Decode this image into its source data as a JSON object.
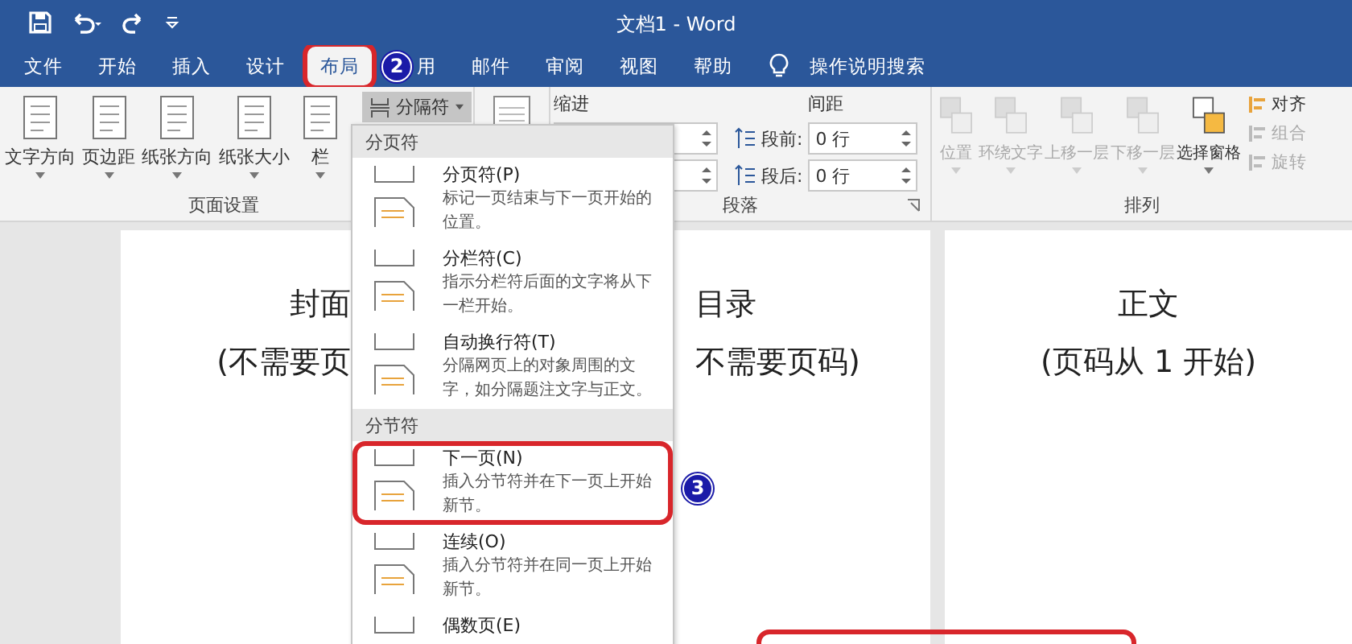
{
  "title_bar": {
    "title": "文档1 - Word"
  },
  "tabs": [
    {
      "label": "文件",
      "selected": false,
      "highlighted": false
    },
    {
      "label": "开始",
      "selected": false,
      "highlighted": false
    },
    {
      "label": "插入",
      "selected": false,
      "highlighted": false
    },
    {
      "label": "设计",
      "selected": false,
      "highlighted": false
    },
    {
      "label": "布局",
      "selected": true,
      "highlighted": true
    },
    {
      "label": "用",
      "selected": false,
      "highlighted": false
    },
    {
      "label": "邮件",
      "selected": false,
      "highlighted": false
    },
    {
      "label": "审阅",
      "selected": false,
      "highlighted": false
    },
    {
      "label": "视图",
      "selected": false,
      "highlighted": false
    },
    {
      "label": "帮助",
      "selected": false,
      "highlighted": false
    }
  ],
  "tell_me": {
    "label": "操作说明搜索"
  },
  "ribbon": {
    "page_setup": {
      "label": "页面设置",
      "buttons": [
        {
          "label": "文字方向"
        },
        {
          "label": "页边距"
        },
        {
          "label": "纸张方向"
        },
        {
          "label": "纸张大小"
        },
        {
          "label": "栏"
        }
      ],
      "breaks_button": {
        "label": "分隔符",
        "pressed": true
      }
    },
    "paragraph": {
      "label": "段落",
      "indent_label": "缩进",
      "spacing_label": "间距",
      "spacing": [
        {
          "label": "段前:",
          "value": "0 行"
        },
        {
          "label": "段后:",
          "value": "0 行"
        }
      ]
    },
    "arrange": {
      "label": "排列",
      "buttons": [
        {
          "label": "位置",
          "disabled": true
        },
        {
          "label": "环绕文字",
          "disabled": true
        },
        {
          "label": "上移一层",
          "disabled": true
        },
        {
          "label": "下移一层",
          "disabled": true
        },
        {
          "label": "选择窗格",
          "disabled": false
        }
      ],
      "small_buttons": [
        {
          "label": "对齐",
          "disabled": false
        },
        {
          "label": "组合",
          "disabled": true
        },
        {
          "label": "旋转",
          "disabled": true
        }
      ]
    }
  },
  "breaks_menu": {
    "sections": [
      {
        "header": "分页符",
        "items": [
          {
            "title": "分页符(P)",
            "description": "标记一页结束与下一页开始的位置。",
            "highlighted": false
          },
          {
            "title": "分栏符(C)",
            "description": "指示分栏符后面的文字将从下一栏开始。",
            "highlighted": false
          },
          {
            "title": "自动换行符(T)",
            "description": "分隔网页上的对象周围的文字，如分隔题注文字与正文。",
            "highlighted": false
          }
        ]
      },
      {
        "header": "分节符",
        "items": [
          {
            "title": "下一页(N)",
            "description": "插入分节符并在下一页上开始新节。",
            "highlighted": true
          },
          {
            "title": "连续(O)",
            "description": "插入分节符并在同一页上开始新节。",
            "highlighted": false
          },
          {
            "title": "偶数页(E)",
            "highlighted": false
          }
        ]
      }
    ]
  },
  "pages": [
    {
      "title": "封面",
      "subtitle": "(不需要页"
    },
    {
      "title": "目录",
      "subtitle": "不需要页码)"
    },
    {
      "title": "正文",
      "subtitle": "(页码从 1 开始)"
    }
  ],
  "callouts": [
    {
      "number": "2"
    },
    {
      "number": "3"
    }
  ]
}
